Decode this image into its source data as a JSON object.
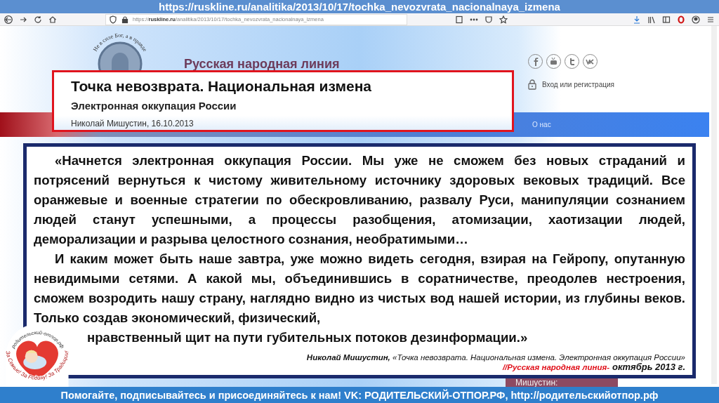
{
  "banner": {
    "url": "https://ruskline.ru/analitika/2013/10/17/tochka_nevozvrata_nacionalnaya_izmena"
  },
  "browser": {
    "address": "https://**ruskline.ru**/analitika/2013/10/17/tochka_nevozvrata_nacionalnaya_izmena"
  },
  "site": {
    "motto": "Не в силе Бог, а в правде",
    "name": "Русская народная линия",
    "login": "Вход или регистрация",
    "nav": [
      {
        "label": "О нас"
      }
    ],
    "behind_label": "Мишустин:"
  },
  "article": {
    "title": "Точка невозврата. Национальная измена",
    "subtitle": "Электронная оккупация России",
    "byline": "Николай Мишустин, 16.10.2013"
  },
  "quote": {
    "paragraphs": [
      "«Начнется электронная оккупация России. Мы уже не сможем без новых страданий и потрясений вернуться к чистому живительному источнику здоровых вековых традиций. Все оранжевые и военные стратегии по обескровливанию, развалу Руси, манипуляции сознанием людей станут успешными, а процессы разобщения, атомизации, хаотизации людей, деморализации и разрыва целостного сознания, необратимыми…",
      "И каким может быть наше завтра, уже можно видеть сегодня, взирая на Гейропу, опутанную невидимыми сетями. А какой мы, объединившись в соратничестве, преодолев нестроения, сможем возродить нашу страну, наглядно видно из чистых вод нашей истории, из глубины веков. Только создав экономический, физический,",
      "нравственный щит на пути губительных потоков дезинформации.»"
    ],
    "attribution": "**Николай Мишустин,** «Точка невозврата. Национальная измена. Электронная оккупация России»",
    "source": "//Русская народная линия-",
    "date": "октябрь 2013 г."
  },
  "logo": {
    "top_text": "родительский-отпор.рф",
    "bottom_text": "За Семью! За Родину! За Традиции!"
  },
  "footer": {
    "text": "Помогайте, подписывайтесь и присоединяйтесь к нам! VK: РОДИТЕЛЬСКИЙ-ОТПОР.РФ, http://родительскийотпор.рф"
  }
}
